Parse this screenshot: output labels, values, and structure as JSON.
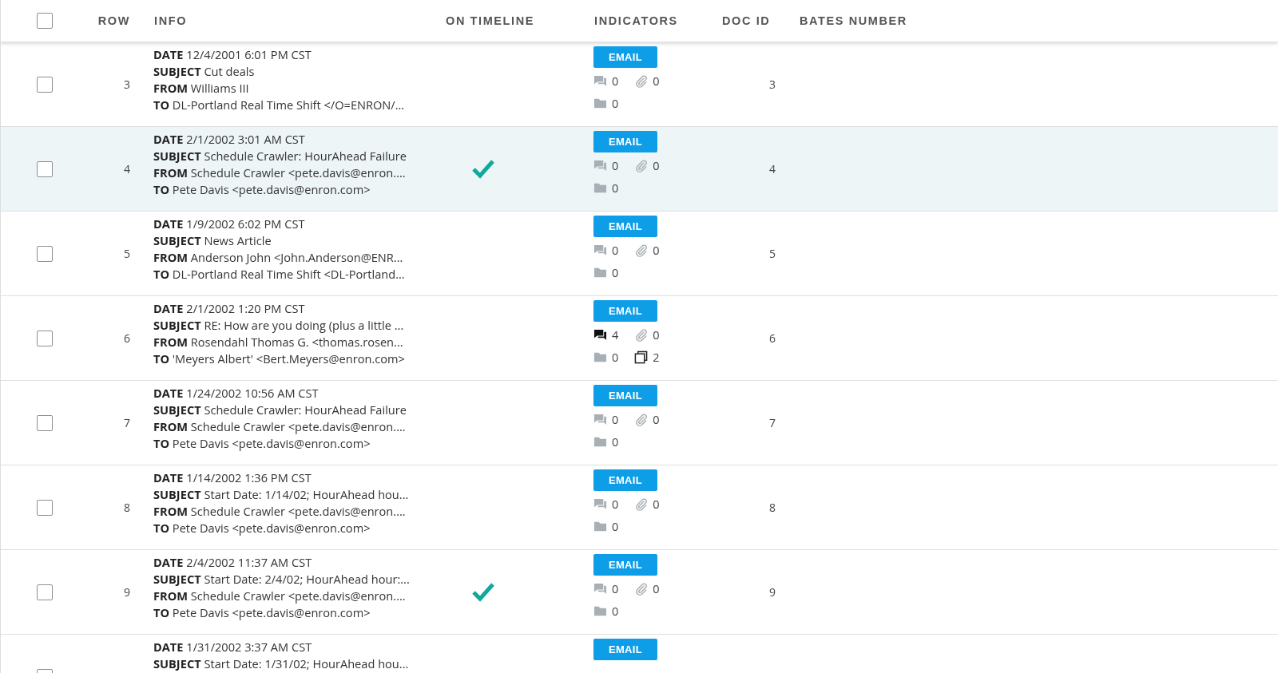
{
  "header": {
    "select_all_checked": false,
    "columns": [
      "ROW",
      "INFO",
      "ON TIMELINE",
      "INDICATORS",
      "DOC ID",
      "BATES NUMBER"
    ]
  },
  "rows": [
    {
      "row": "3",
      "highlighted": false,
      "checked": false,
      "info": [
        "**DATE** 12/4/2001 6:01 PM CST",
        "**SUBJECT** Cut deals",
        "**FROM** Williams III",
        "**TO** DL-Portland Real Time Shift </O=ENRON/..."
      ],
      "on_timeline": false,
      "tag": "EMAIL",
      "comments": "0",
      "comments_active": false,
      "attachments": "0",
      "folders": "0",
      "doc_id": "3"
    },
    {
      "row": "4",
      "highlighted": true,
      "checked": false,
      "info": [
        "**DATE** 2/1/2002 3:01 AM CST",
        "**SUBJECT** Schedule Crawler: HourAhead Failure",
        "**FROM** Schedule Crawler <pete.davis@enron....",
        "**TO** Pete Davis <pete.davis@enron.com>"
      ],
      "on_timeline": true,
      "tag": "EMAIL",
      "comments": "0",
      "comments_active": false,
      "attachments": "0",
      "folders": "0",
      "doc_id": "4"
    },
    {
      "row": "5",
      "highlighted": false,
      "checked": false,
      "info": [
        "**DATE** 1/9/2002 6:02 PM CST",
        "**SUBJECT** News Article",
        "**FROM** Anderson John <John.Anderson@ENR...",
        "**TO** DL-Portland Real Time Shift <DL-Portland..."
      ],
      "on_timeline": false,
      "tag": "EMAIL",
      "comments": "0",
      "comments_active": false,
      "attachments": "0",
      "folders": "0",
      "doc_id": "5"
    },
    {
      "row": "6",
      "highlighted": false,
      "checked": false,
      "info": [
        "**DATE** 2/1/2002 1:20 PM CST",
        "**SUBJECT** RE: How are you doing (plus a little ...",
        "**FROM** Rosendahl Thomas G. <thomas.rosen...",
        "**TO** 'Meyers Albert' <Bert.Meyers@enron.com>"
      ],
      "on_timeline": false,
      "tag": "EMAIL",
      "comments": "4",
      "comments_active": true,
      "attachments": "0",
      "folders": "0",
      "duplicates": "2",
      "doc_id": "6"
    },
    {
      "row": "7",
      "highlighted": false,
      "checked": false,
      "info": [
        "**DATE** 1/24/2002 10:56 AM CST",
        "**SUBJECT** Schedule Crawler: HourAhead Failure",
        "**FROM** Schedule Crawler <pete.davis@enron....",
        "**TO** Pete Davis <pete.davis@enron.com>"
      ],
      "on_timeline": false,
      "tag": "EMAIL",
      "comments": "0",
      "comments_active": false,
      "attachments": "0",
      "folders": "0",
      "doc_id": "7"
    },
    {
      "row": "8",
      "highlighted": false,
      "checked": false,
      "info": [
        "**DATE** 1/14/2002 1:36 PM CST",
        "**SUBJECT** Start Date: 1/14/02; HourAhead hou...",
        "**FROM** Schedule Crawler <pete.davis@enron....",
        "**TO** Pete Davis <pete.davis@enron.com>"
      ],
      "on_timeline": false,
      "tag": "EMAIL",
      "comments": "0",
      "comments_active": false,
      "attachments": "0",
      "folders": "0",
      "doc_id": "8"
    },
    {
      "row": "9",
      "highlighted": false,
      "checked": false,
      "info": [
        "**DATE** 2/4/2002 11:37 AM CST",
        "**SUBJECT** Start Date: 2/4/02; HourAhead hour:...",
        "**FROM** Schedule Crawler <pete.davis@enron....",
        "**TO** Pete Davis <pete.davis@enron.com>"
      ],
      "on_timeline": true,
      "tag": "EMAIL",
      "comments": "0",
      "comments_active": false,
      "attachments": "0",
      "folders": "0",
      "doc_id": "9"
    },
    {
      "highlighted": false,
      "checked": false,
      "info": [
        "**DATE** 1/31/2002 3:37 AM CST",
        "**SUBJECT** Start Date: 1/31/02; HourAhead hou..."
      ],
      "on_timeline": false,
      "tag": "EMAIL"
    }
  ]
}
